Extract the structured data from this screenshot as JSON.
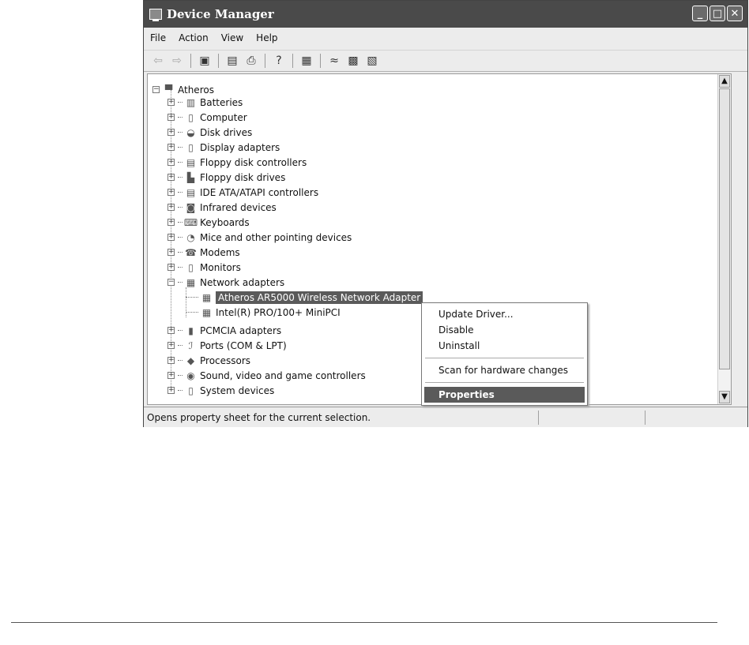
{
  "window": {
    "title": "Device Manager",
    "min": "_",
    "max": "□",
    "close": "✕"
  },
  "menu": [
    "File",
    "Action",
    "View",
    "Help"
  ],
  "toolbar": {
    "icons": [
      "back-icon",
      "forward-icon",
      "show-hide-tree-icon",
      "properties-icon",
      "print-icon",
      "help-icon",
      "scan-hardware-icon",
      "update-driver-icon",
      "uninstall-icon",
      "disable-icon"
    ]
  },
  "tree": {
    "root": "Atheros",
    "categories": [
      "Batteries",
      "Computer",
      "Disk drives",
      "Display adapters",
      "Floppy disk controllers",
      "Floppy disk drives",
      "IDE ATA/ATAPI controllers",
      "Infrared devices",
      "Keyboards",
      "Mice and other pointing devices",
      "Modems",
      "Monitors",
      "Network adapters"
    ],
    "network_children": [
      "Atheros AR5000 Wireless Network Adapter",
      "Intel(R) PRO/100+ MiniPCI"
    ],
    "more_categories": [
      "PCMCIA adapters",
      "Ports (COM & LPT)",
      "Processors",
      "Sound, video and game controllers",
      "System devices"
    ]
  },
  "context_menu": {
    "update": "Update Driver...",
    "disable": "Disable",
    "uninstall": "Uninstall",
    "scan": "Scan for hardware changes",
    "properties": "Properties"
  },
  "status": "Opens property sheet for the current selection."
}
